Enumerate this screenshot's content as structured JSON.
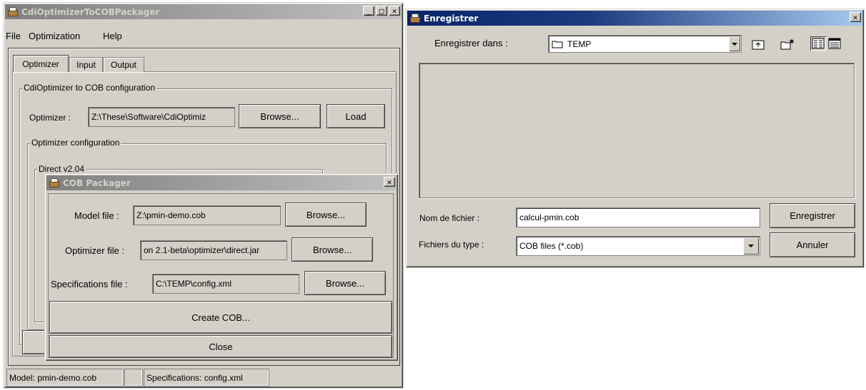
{
  "main_window": {
    "title": "CdiOptimizerToCOBPackager",
    "menu": [
      "File",
      "Optimization",
      "Help"
    ],
    "tabs": [
      "Optimizer",
      "Input",
      "Output"
    ],
    "group_title": "CdiOptimizer to COB configuration",
    "optimizer_label": "Optimizer :",
    "optimizer_value": "Z:\\These\\Software\\CdiOptimiz",
    "browse_label": "Browse...",
    "load_label": "Load",
    "opt_config_title": "Optimizer configuration",
    "direct_title": "Direct v2.04",
    "status": {
      "model": "Model: pmin-demo.cob",
      "specifications": "Specifications: config.xml"
    }
  },
  "cob_dialog": {
    "title": "COB Packager",
    "model_label": "Model file :",
    "model_value": "Z:\\pmin-demo.cob",
    "optimizer_label": "Optimizer file :",
    "optimizer_value": "on 2.1-beta\\optimizer\\direct.jar",
    "spec_label": "Specifications file :",
    "spec_value": "C:\\TEMP\\config.xml",
    "browse_label": "Browse...",
    "create_label": "Create COB...",
    "close_label": "Close"
  },
  "save_dialog": {
    "title": "Enregistrer",
    "save_in_label": "Enregistrer dans :",
    "save_in_value": "TEMP",
    "filename_label": "Nom de fichier :",
    "filename_value": "calcul-pmin.cob",
    "filetype_label": "Fichiers du type :",
    "filetype_value": "COB files (*.cob)",
    "save_button": "Enregistrer",
    "cancel_button": "Annuler"
  },
  "icons": {
    "app": "java-coffee-icon",
    "folder": "folder-icon",
    "up": "up-folder-icon",
    "new_folder": "new-folder-icon",
    "list_view": "list-view-icon",
    "details_view": "details-view-icon"
  }
}
